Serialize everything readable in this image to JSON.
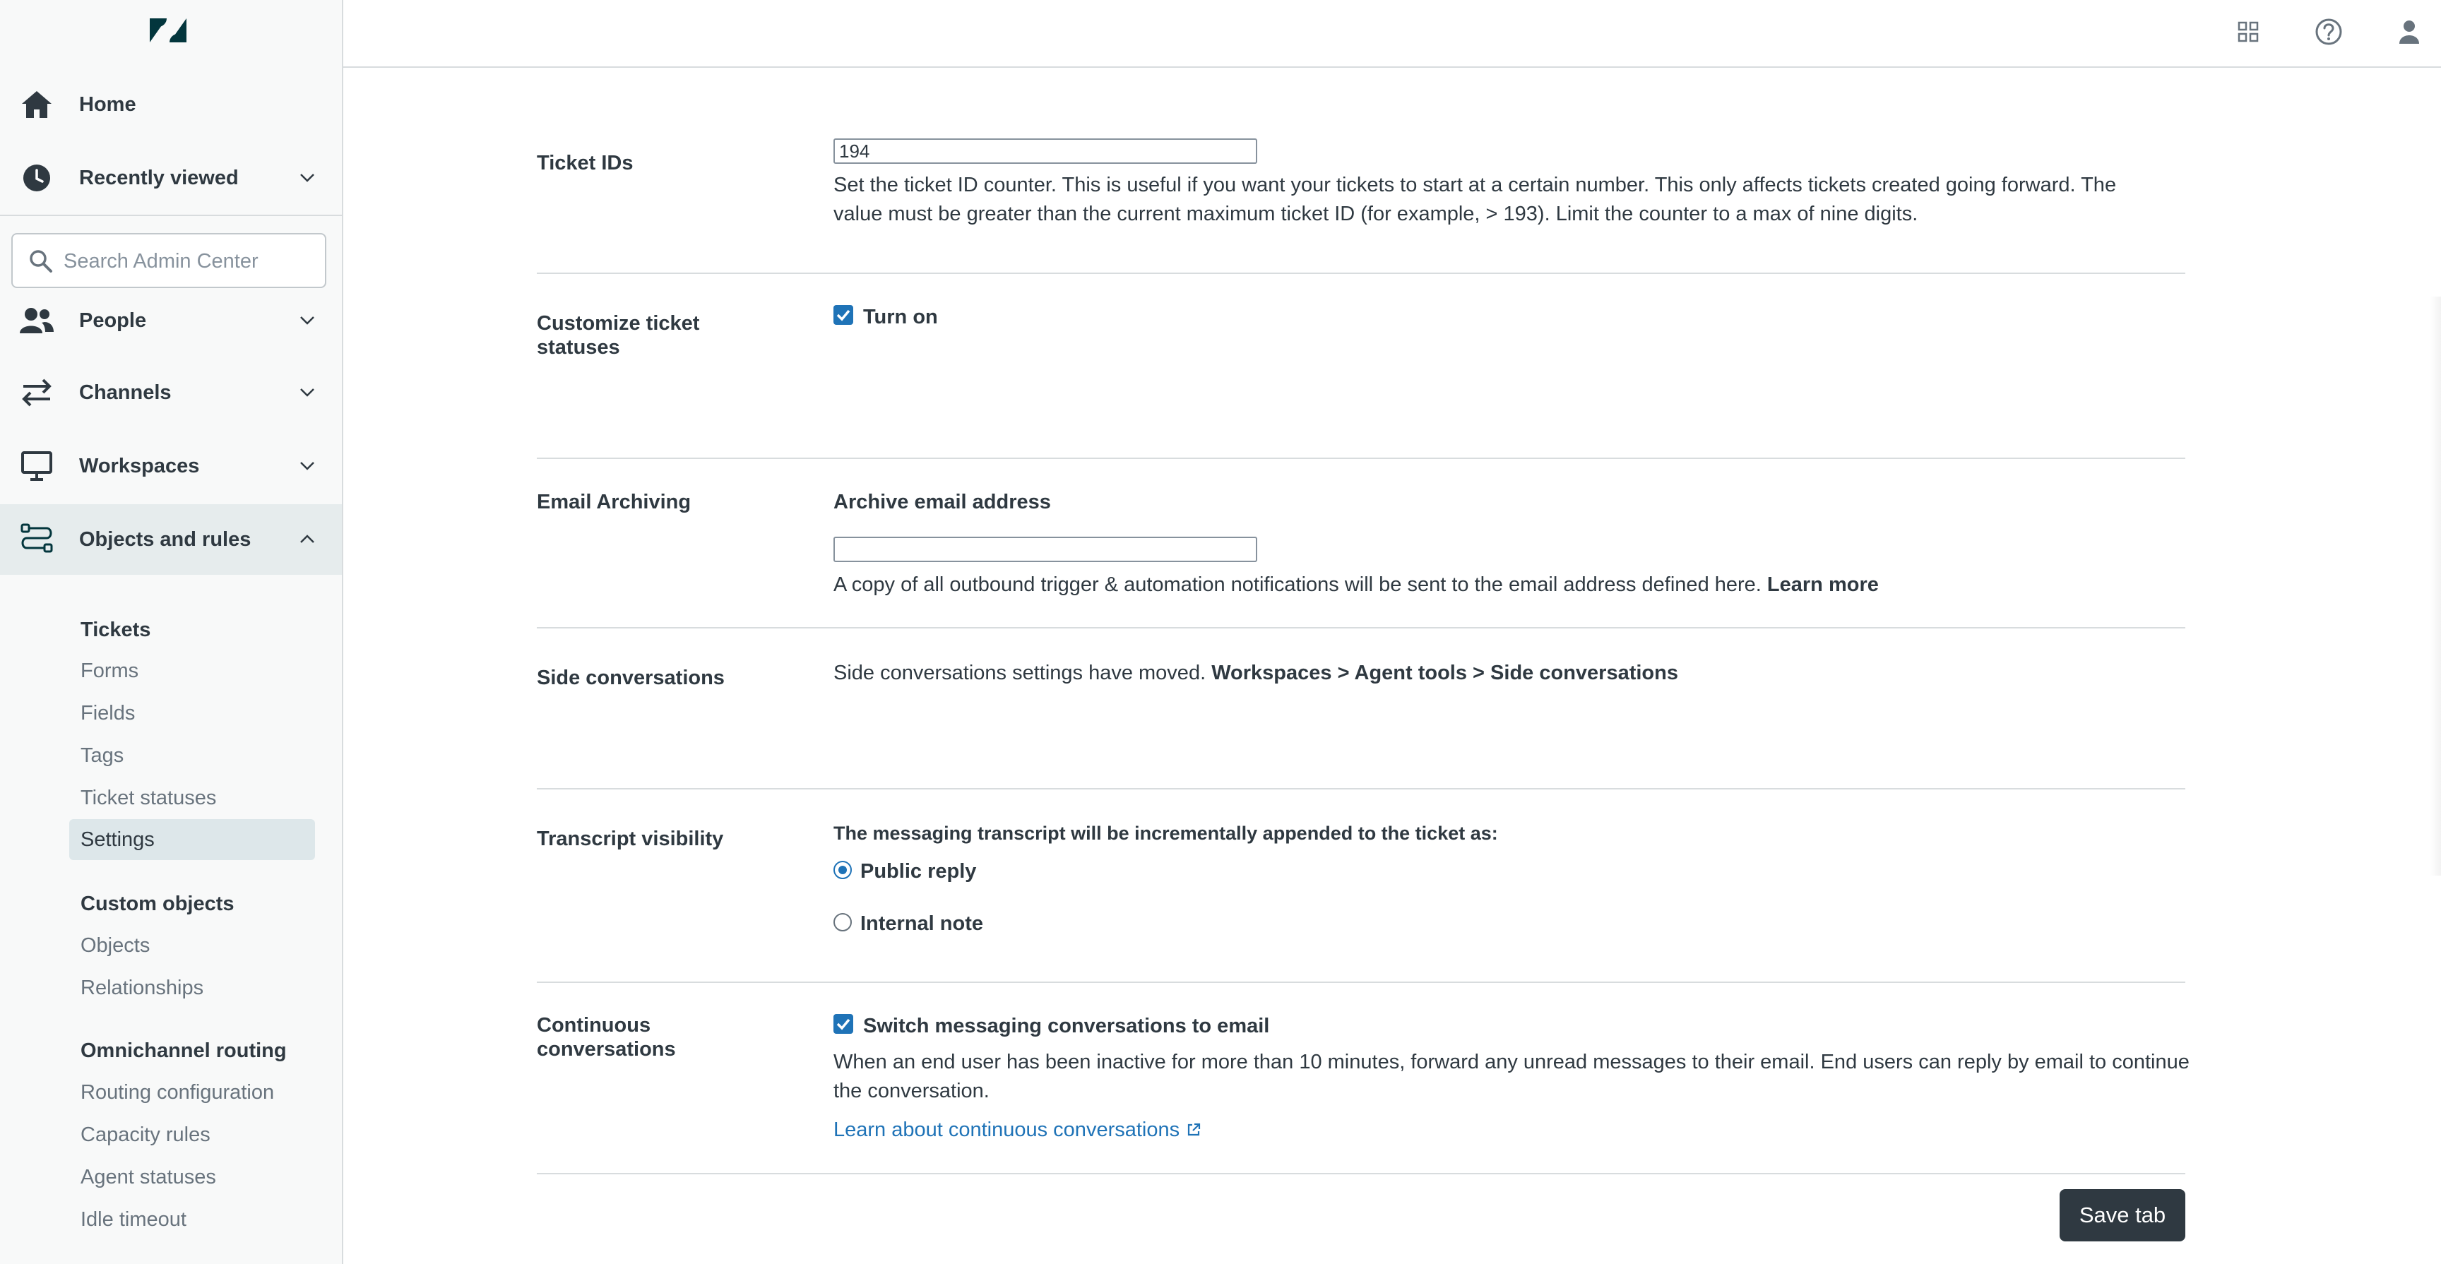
{
  "colors": {
    "accent": "#1f73b7",
    "text": "#2f3941",
    "muted": "#68737d",
    "sidebar_bg": "#f8f9f9",
    "active_bg": "#dde7ea",
    "button_bg": "#2f3941"
  },
  "sidebar": {
    "logo_icon": "zendesk-logo",
    "nav": {
      "home": "Home",
      "recently_viewed": "Recently viewed",
      "people": "People",
      "channels": "Channels",
      "workspaces": "Workspaces",
      "objects_and_rules": "Objects and rules"
    },
    "search_placeholder": "Search Admin Center",
    "tickets": {
      "heading": "Tickets",
      "items": [
        "Forms",
        "Fields",
        "Tags",
        "Ticket statuses",
        "Settings"
      ]
    },
    "custom_objects": {
      "heading": "Custom objects",
      "items": [
        "Objects",
        "Relationships"
      ]
    },
    "omnichannel": {
      "heading": "Omnichannel routing",
      "items": [
        "Routing configuration",
        "Capacity rules",
        "Agent statuses",
        "Idle timeout"
      ]
    }
  },
  "topbar": {
    "icons": [
      "products-grid-icon",
      "help-icon",
      "user-avatar-icon"
    ]
  },
  "main": {
    "ticket_ids": {
      "label": "Ticket IDs",
      "value": "194",
      "help_line1": "Set the ticket ID counter. This is useful if you want your tickets to start at a certain number. This only affects tickets created going forward. The",
      "help_line2": "value must be greater than the current maximum ticket ID (for example, > 193). Limit the counter to a max of nine digits."
    },
    "custom_statuses": {
      "label_line1": "Customize ticket",
      "label_line2": "statuses",
      "checkbox_label": "Turn on",
      "checked": true
    },
    "email_archiving": {
      "label": "Email Archiving",
      "field_label": "Archive email address",
      "value": "",
      "help": "A copy of all outbound trigger & automation notifications will be sent to the email address defined here.",
      "learn_more": "Learn more"
    },
    "side_conversations": {
      "label": "Side conversations",
      "text": "Side conversations settings have moved.",
      "path": "Workspaces > Agent tools > Side conversations"
    },
    "transcript": {
      "label": "Transcript visibility",
      "heading": "The messaging transcript will be incrementally appended to the ticket as:",
      "options": [
        "Public reply",
        "Internal note"
      ],
      "selected": "Public reply"
    },
    "continuous": {
      "label_line1": "Continuous",
      "label_line2": "conversations",
      "checkbox_label": "Switch messaging conversations to email",
      "checked": true,
      "help_line1": "When an end user has been inactive for more than 10 minutes, forward any unread messages to their email. End users can reply by email to continue",
      "help_line2": "the conversation.",
      "link": "Learn about continuous conversations"
    },
    "save_label": "Save tab"
  }
}
